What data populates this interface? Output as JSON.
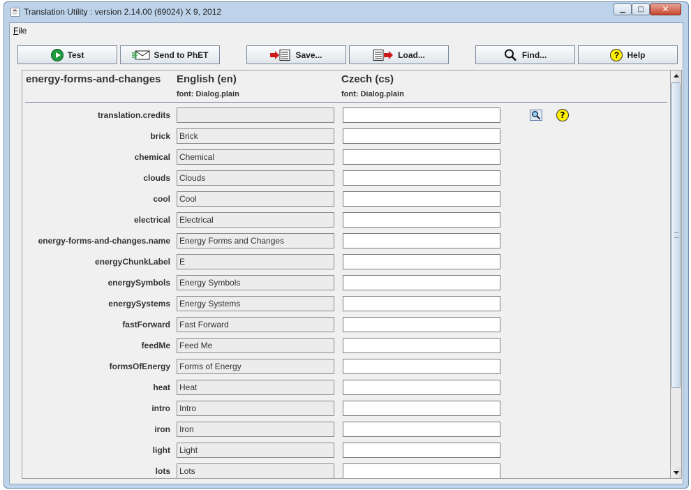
{
  "window": {
    "title": "Translation Utility : version 2.14.00 (69024) X 9, 2012",
    "min_glyph": "▁",
    "max_glyph": "□",
    "close_glyph": "✕"
  },
  "menubar": {
    "file_mnemonic": "F",
    "file_rest": "ile"
  },
  "toolbar": {
    "test": "Test",
    "send": "Send to PhET",
    "save": "Save...",
    "load": "Load...",
    "find": "Find...",
    "help": "Help",
    "help_glyph": "?"
  },
  "header": {
    "project": "energy-forms-and-changes",
    "source_lang": "English (en)",
    "target_lang": "Czech (cs)",
    "source_font": "font: Dialog.plain",
    "target_font": "font: Dialog.plain"
  },
  "rows": [
    {
      "key": "translation.credits",
      "source": "",
      "target": ""
    },
    {
      "key": "brick",
      "source": "Brick",
      "target": ""
    },
    {
      "key": "chemical",
      "source": "Chemical",
      "target": ""
    },
    {
      "key": "clouds",
      "source": "Clouds",
      "target": ""
    },
    {
      "key": "cool",
      "source": "Cool",
      "target": ""
    },
    {
      "key": "electrical",
      "source": "Electrical",
      "target": ""
    },
    {
      "key": "energy-forms-and-changes.name",
      "source": "Energy Forms and Changes",
      "target": ""
    },
    {
      "key": "energyChunkLabel",
      "source": "E",
      "target": ""
    },
    {
      "key": "energySymbols",
      "source": "Energy Symbols",
      "target": ""
    },
    {
      "key": "energySystems",
      "source": "Energy Systems",
      "target": ""
    },
    {
      "key": "fastForward",
      "source": "Fast Forward",
      "target": ""
    },
    {
      "key": "feedMe",
      "source": "Feed Me",
      "target": ""
    },
    {
      "key": "formsOfEnergy",
      "source": "Forms of Energy",
      "target": ""
    },
    {
      "key": "heat",
      "source": "Heat",
      "target": ""
    },
    {
      "key": "intro",
      "source": "Intro",
      "target": ""
    },
    {
      "key": "iron",
      "source": "Iron",
      "target": ""
    },
    {
      "key": "light",
      "source": "Light",
      "target": ""
    },
    {
      "key": "lots",
      "source": "Lots",
      "target": ""
    }
  ],
  "credits_help_glyph": "?"
}
